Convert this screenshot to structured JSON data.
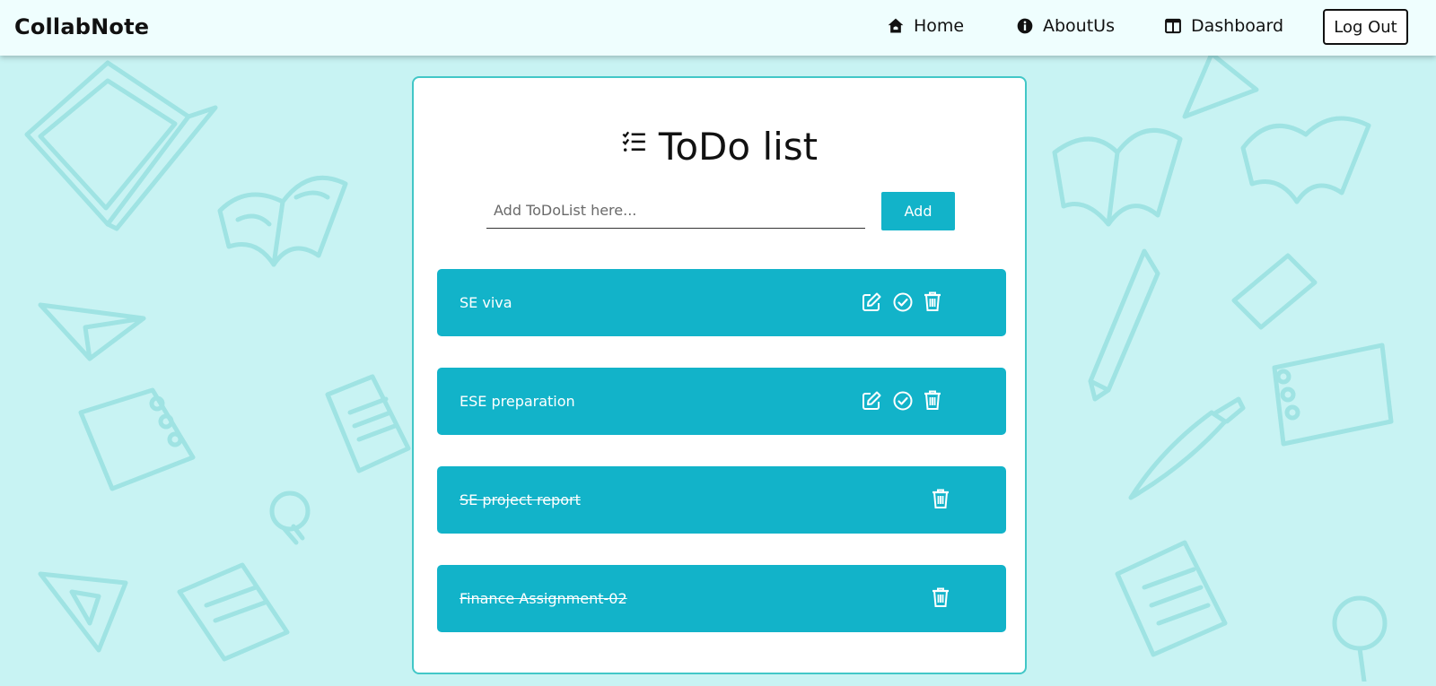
{
  "navbar": {
    "brand": "CollabNote",
    "home_label": "Home",
    "about_label": "AboutUs",
    "dashboard_label": "Dashboard",
    "logout_label": "Log Out",
    "home_icon": "house-icon",
    "about_icon": "info-circle-icon",
    "dashboard_icon": "layout-columns-icon"
  },
  "card": {
    "title": "ToDo list",
    "title_icon": "checklist-icon",
    "input_placeholder": "Add ToDoList here...",
    "input_value": "",
    "add_label": "Add"
  },
  "todos": [
    {
      "text": "SE viva",
      "done": false
    },
    {
      "text": "ESE preparation",
      "done": false
    },
    {
      "text": "SE project report",
      "done": true
    },
    {
      "text": "Finance Assignment-02",
      "done": true
    }
  ],
  "colors": {
    "background": "#c8f3f3",
    "accent": "#12b3c9",
    "navbar": "#effefe"
  }
}
